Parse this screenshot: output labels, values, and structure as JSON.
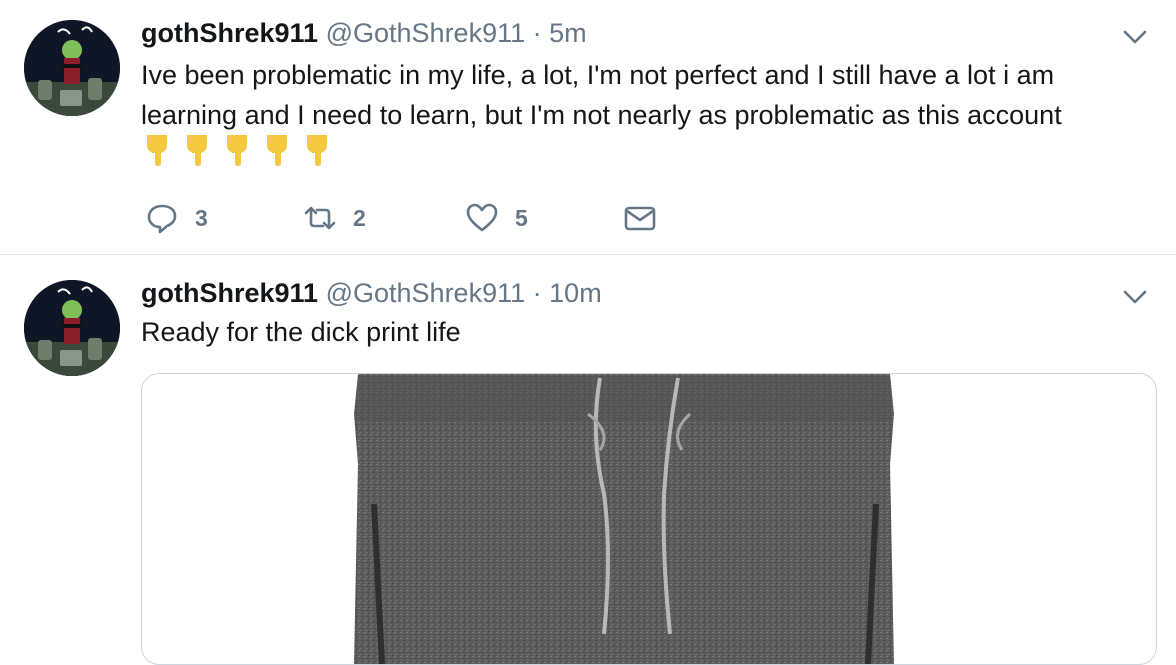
{
  "tweets": [
    {
      "name": "gothShrek911",
      "handle": "@GothShrek911",
      "separator": "·",
      "time": "5m",
      "text_lines": [
        "Ive been problematic in my life, a lot, I'm not perfect and I still have a lot i am",
        "learning and I need to learn, but I'm not nearly as problematic as this account"
      ],
      "emojis": [
        "pointing-down-emoji",
        "pointing-down-emoji",
        "pointing-down-emoji",
        "pointing-down-emoji",
        "pointing-down-emoji"
      ],
      "actions": {
        "reply_count": "3",
        "retweet_count": "2",
        "like_count": "5"
      }
    },
    {
      "name": "gothShrek911",
      "handle": "@GothShrek911",
      "separator": "·",
      "time": "10m",
      "text_lines": [
        "Ready for the dick print life"
      ],
      "media": {
        "description_icon": "sweatpants-photo"
      }
    }
  ],
  "icons": {
    "avatar": "avatar-image",
    "menu": "chevron-down-icon",
    "reply": "reply-icon",
    "retweet": "retweet-icon",
    "like": "heart-icon",
    "dm": "envelope-icon"
  },
  "colors": {
    "text": "#14171a",
    "secondary": "#657786",
    "divider": "#e1e8ed",
    "emoji": "#f5c842"
  }
}
